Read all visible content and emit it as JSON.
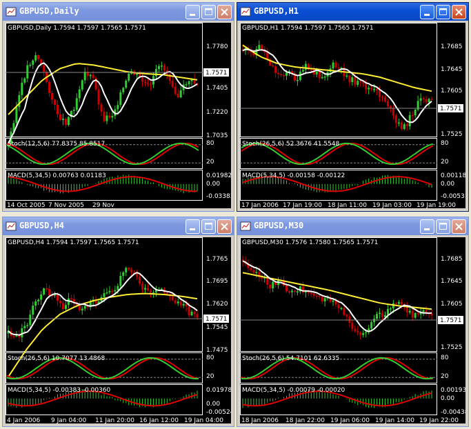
{
  "windows": [
    {
      "id": "daily",
      "title": "GBPUSD,Daily",
      "active": false,
      "header": "GBPUSD,Daily  1.7594 1.7597 1.7565 1.7571",
      "price_ticks": [
        "1.7780",
        "1.7405",
        "1.7220",
        "1.7035"
      ],
      "current_price": "1.7571",
      "stoch_label": "Stoch(12,5,6) 77.8375 85.8517",
      "stoch_levels": [
        "80",
        "20"
      ],
      "macd_label": "MACD(5,34,5) 0.00763 0.01183",
      "macd_levels": [
        "0.01982",
        "0.00",
        "-0.03383"
      ],
      "time_labels": [
        "14 Oct 2005",
        "7 Nov 2005",
        "29 Nov"
      ]
    },
    {
      "id": "h1",
      "title": "GBPUSD,H1",
      "active": true,
      "header": "GBPUSD,H1  1.7594 1.7597 1.7565 1.7571",
      "price_ticks": [
        "1.7685",
        "1.7645",
        "1.7605",
        "1.7525"
      ],
      "current_price": "1.7571",
      "stoch_label": "Stoch(26,5,6) 52.3676 41.5548",
      "stoch_levels": [
        "80",
        "20"
      ],
      "macd_label": "MACD(5,34,5) -0.00158 -0.00122",
      "macd_levels": [
        "0.00118",
        "0.00",
        "-0.00531"
      ],
      "time_labels": [
        "17 Jan 2006",
        "17 Jan 19:00",
        "18 Jan 11:00",
        "19 Jan 03:00",
        "19 Jan 19:00"
      ]
    },
    {
      "id": "h4",
      "title": "GBPUSD,H4",
      "active": false,
      "header": "GBPUSD,H4  1.7594 1.7597 1.7565 1.7571",
      "price_ticks": [
        "1.7765",
        "1.7695",
        "1.7620",
        "1.7545",
        "1.7475"
      ],
      "current_price": "1.7571",
      "stoch_label": "Stoch(26,5,6) 10.7077 13.4868",
      "stoch_levels": [
        "80",
        "20"
      ],
      "macd_label": "MACD(5,34,5) -0.00383 -0.00360",
      "macd_levels": [
        "0.01978",
        "0.00",
        "-0.00524"
      ],
      "time_labels": [
        "4 Jan 2006",
        "9 Jan 04:00",
        "11 Jan 20:00",
        "16 Jan 12:00",
        "19 Jan 04:00"
      ]
    },
    {
      "id": "m30",
      "title": "GBPUSD,M30",
      "active": false,
      "header": "GBPUSD,M30  1.7576 1.7580 1.7565 1.7571",
      "price_ticks": [
        "1.7685",
        "1.7645",
        "1.7605",
        "1.7525"
      ],
      "current_price": "1.7571",
      "stoch_label": "Stoch(26,5,6) 54.7101 62.6335",
      "stoch_levels": [
        "80",
        "20"
      ],
      "macd_label": "MACD(5,34,5) -0.00079 -0.00020",
      "macd_levels": [
        "0.00193",
        "0.00",
        "-0.00438"
      ],
      "time_labels": [
        "18 Jan 2006",
        "18 Jan 22:00",
        "19 Jan 06:00",
        "19 Jan 14:00",
        "19 Jan 22:00"
      ]
    }
  ],
  "colors": {
    "bull": "#33cc33",
    "bear": "#cc0000",
    "ma_fast": "#ffffff",
    "ma_slow": "#ffee33",
    "stoch_main": "#33cc33",
    "stoch_signal": "#e00000",
    "macd_hist": "#33cc33",
    "macd_signal": "#e00000",
    "titlebar_active": "#0a4fd4",
    "titlebar_inactive": "#7d98df"
  }
}
